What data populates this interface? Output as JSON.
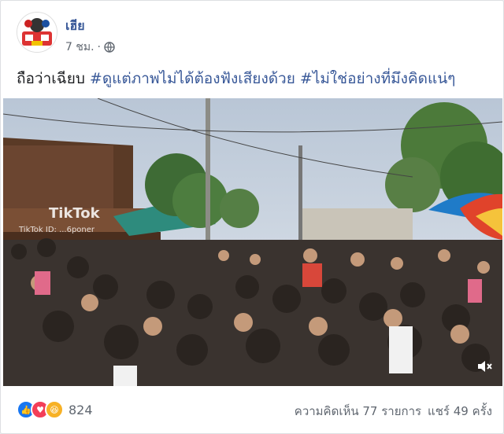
{
  "post": {
    "author": "เฮีย",
    "time": "7 ชม.",
    "text_plain": "ถือว่าเฉียบ ",
    "hashtags": [
      "#ดูแต่ภาพไม่ได้ต้องฟังเสียงด้วย",
      "#ไม่ใช่อย่างที่มึงคิดแน่ๆ"
    ],
    "privacy_icon": "globe-icon"
  },
  "video": {
    "watermark": "TikTok",
    "watermark_user": "TikTok ID: ...6poner",
    "mute_icon": "speaker-muted-icon"
  },
  "footer": {
    "reaction_count": "824",
    "reactions": [
      "like",
      "love",
      "haha"
    ],
    "comments": "ความคิดเห็น 77 รายการ",
    "shares": "แชร์ 49 ครั้ง"
  },
  "colors": {
    "link": "#385898",
    "like": "#1877f2",
    "love": "#f33e58",
    "haha": "#f7b125"
  }
}
